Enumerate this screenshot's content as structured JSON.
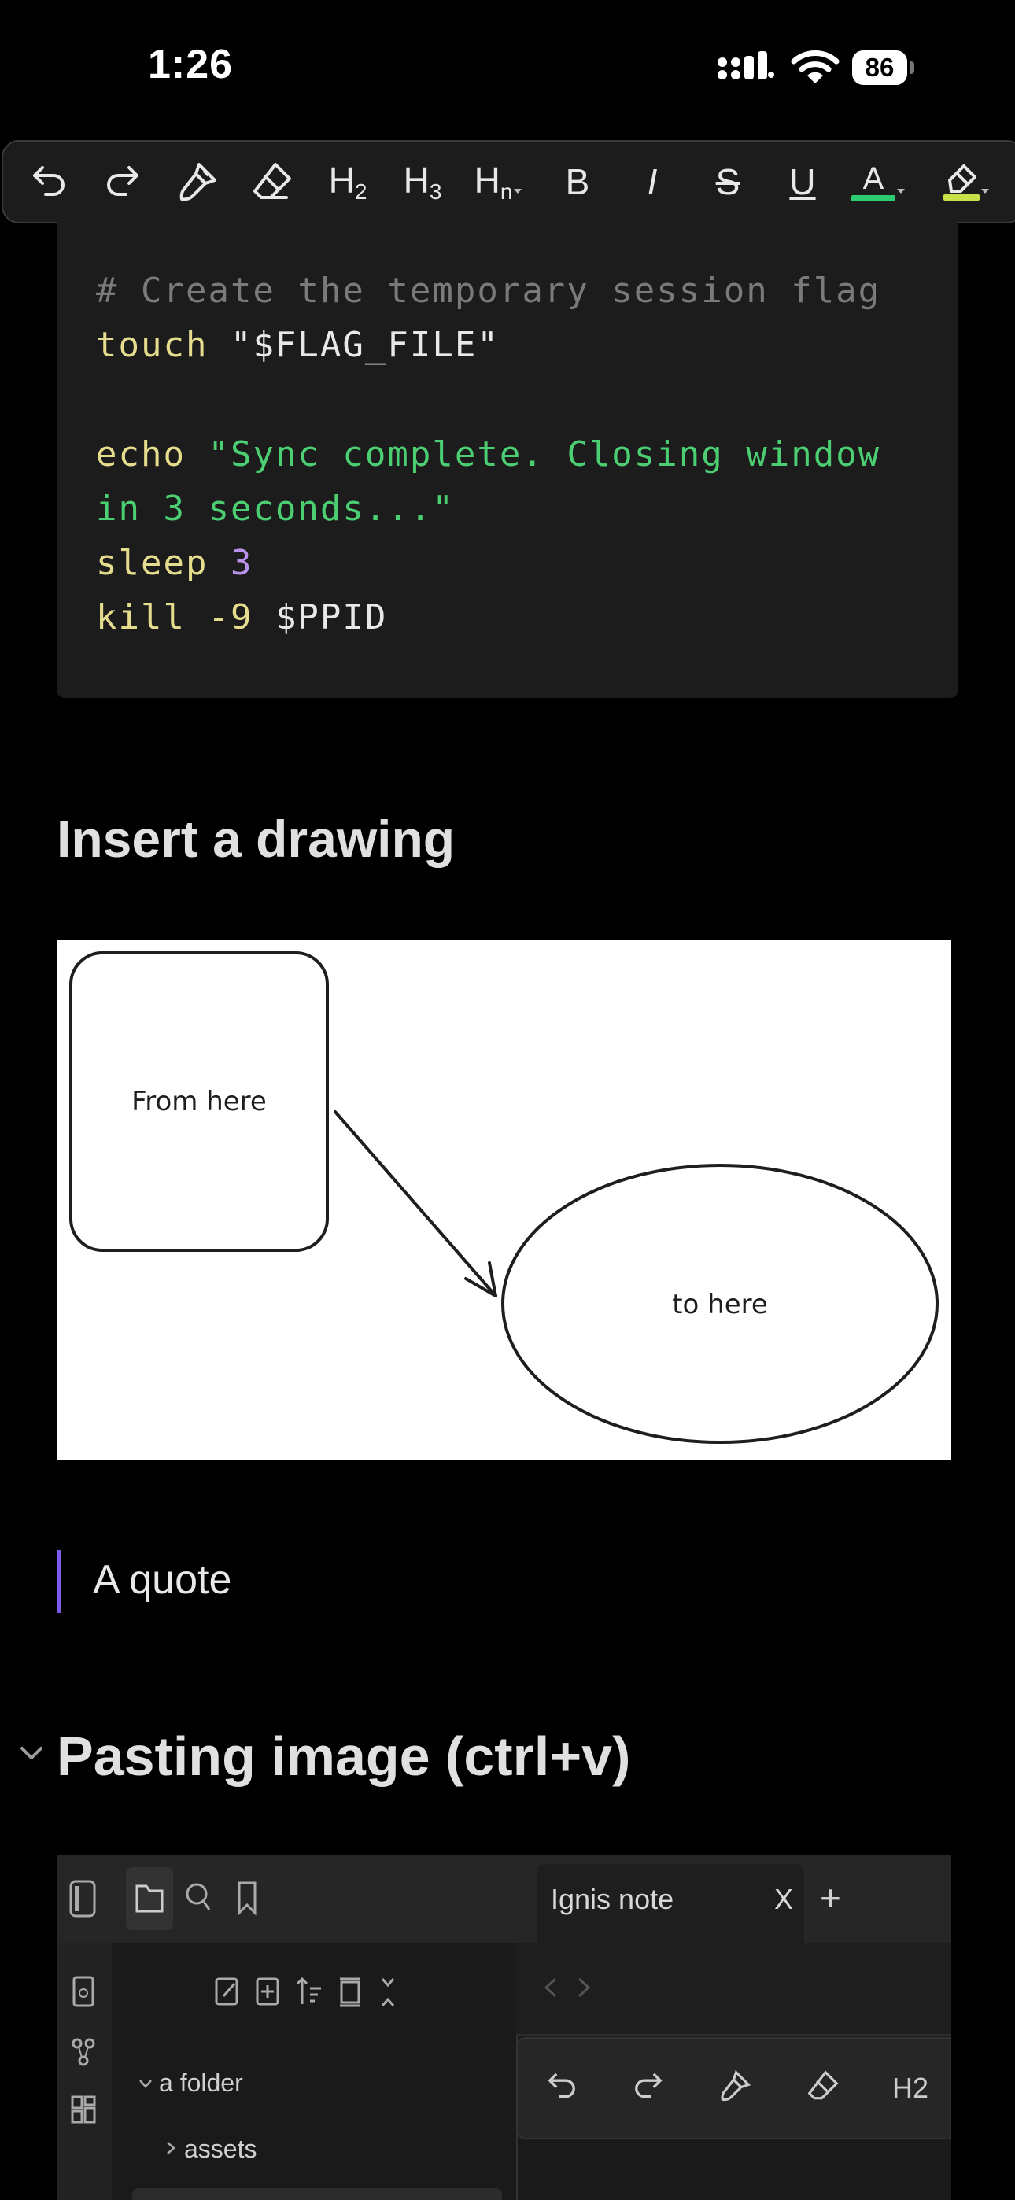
{
  "status_bar": {
    "time": "1:26",
    "battery": "86"
  },
  "toolbar": {
    "items": [
      {
        "name": "undo-icon"
      },
      {
        "name": "redo-icon"
      },
      {
        "name": "paint-brush-icon"
      },
      {
        "name": "eraser-icon"
      },
      {
        "label": "H2"
      },
      {
        "label": "H3"
      },
      {
        "label": "Hn"
      },
      {
        "label": "B"
      },
      {
        "label": "I"
      },
      {
        "label": "S"
      },
      {
        "label": "U"
      },
      {
        "label": "A",
        "color": "#2ecc71"
      },
      {
        "name": "highlighter-icon",
        "color": "#c8e04a"
      }
    ]
  },
  "code_block": {
    "comment": "# Create the temporary session flag",
    "line2_cmd": "touch",
    "line2_arg": "\"$FLAG_FILE\"",
    "line4_cmd": "echo",
    "line4_str_a": "\"Sync complete. Closing window",
    "line4_str_b": "in 3 seconds...\"",
    "line6_cmd": "sleep",
    "line6_num": "3",
    "line7_cmd": "kill -9",
    "line7_arg": "$PPID"
  },
  "drawing_section": {
    "heading": "Insert a drawing"
  },
  "drawing": {
    "box_label": "From here",
    "ellipse_label": "to here"
  },
  "quote": {
    "text": "A quote"
  },
  "pasting_section": {
    "heading": "Pasting image (ctrl+v)"
  },
  "pasted_screenshot": {
    "tab_title": "Ignis note",
    "tab_close": "X",
    "tab_add": "+",
    "folder": "a folder",
    "subfolder": "assets"
  },
  "colors": {
    "accent_purple": "#7c5be8",
    "code_string": "#4ccf73",
    "code_command": "#e6dc8e",
    "code_number": "#b793ee",
    "code_comment": "#7a7a7a"
  }
}
